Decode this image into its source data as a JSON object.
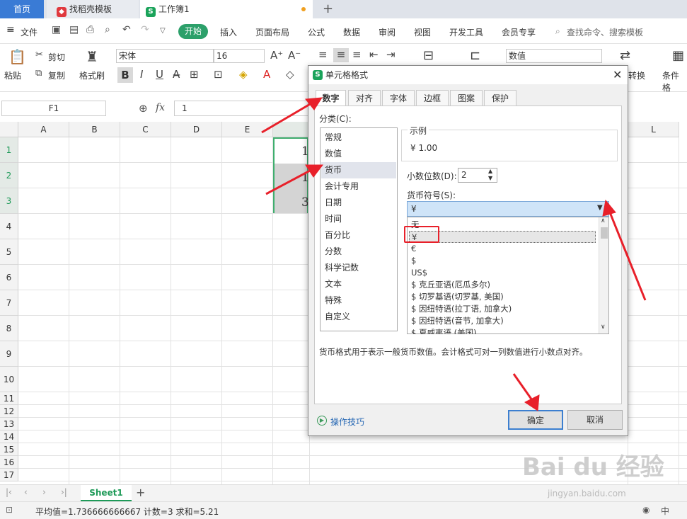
{
  "tabs": {
    "home": "首页",
    "template": "找稻壳模板",
    "workbook": "工作簿1"
  },
  "menu": {
    "file": "文件",
    "start": "开始",
    "insert": "插入",
    "layout": "页面布局",
    "formula": "公式",
    "data": "数据",
    "review": "审阅",
    "view": "视图",
    "dev": "开发工具",
    "member": "会员专享",
    "search": "查找命令、搜索模板"
  },
  "ribbon": {
    "cut": "剪切",
    "paste": "粘贴",
    "copy": "复制",
    "format_painter": "格式刷",
    "font_name": "宋体",
    "font_size": "16",
    "number_format": "数值",
    "convert": "转换",
    "conditional": "条件格"
  },
  "formula_bar": {
    "name_box": "F1",
    "fx": "fx",
    "value": "1"
  },
  "columns": [
    "A",
    "B",
    "C",
    "D",
    "E",
    "L"
  ],
  "rows": [
    "1",
    "2",
    "3",
    "4",
    "5",
    "6",
    "7",
    "8",
    "9",
    "10",
    "11",
    "12",
    "13",
    "14",
    "15",
    "16",
    "17"
  ],
  "cells": [
    "1",
    "1",
    "3"
  ],
  "sheet": {
    "name": "Sheet1"
  },
  "status": {
    "text": "平均值=1.736666666667  计数=3  求和=5.21"
  },
  "dialog": {
    "title": "单元格格式",
    "tabs": [
      "数字",
      "对齐",
      "字体",
      "边框",
      "图案",
      "保护"
    ],
    "category_label": "分类(C):",
    "categories": [
      "常规",
      "数值",
      "货币",
      "会计专用",
      "日期",
      "时间",
      "百分比",
      "分数",
      "科学记数",
      "文本",
      "特殊",
      "自定义"
    ],
    "sample_label": "示例",
    "sample_value": "¥ 1.00",
    "decimal_label": "小数位数(D):",
    "decimal_value": "2",
    "symbol_label": "货币符号(S):",
    "symbol_value": "¥",
    "symbol_options": [
      "无",
      "¥",
      "€",
      "$",
      "US$",
      "$ 克丘亚语(厄瓜多尔)",
      "$ 切罗基语(切罗基, 美国)",
      "$ 因纽特语(拉丁语, 加拿大)",
      "$ 因纽特语(音节, 加拿大)",
      "$ 夏威夷语 (美国)"
    ],
    "description": "货币格式用于表示一般货币数值。会计格式可对一列数值进行小数点对齐。",
    "tips": "操作技巧",
    "ok": "确定",
    "cancel": "取消"
  },
  "watermark": {
    "text": "Bai du 经验",
    "url": "jingyan.baidu.com"
  },
  "colors": {
    "accent_green": "#2ca06a",
    "home_tab": "#3a7bd5",
    "arrow_red": "#e8202a"
  }
}
